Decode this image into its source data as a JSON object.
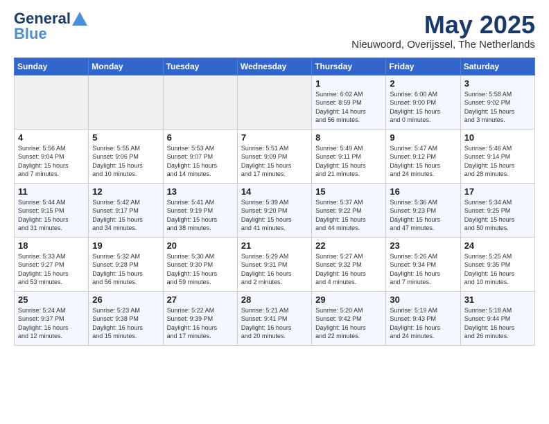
{
  "header": {
    "logo_line1": "General",
    "logo_line2": "Blue",
    "month": "May 2025",
    "location": "Nieuwoord, Overijssel, The Netherlands"
  },
  "days_of_week": [
    "Sunday",
    "Monday",
    "Tuesday",
    "Wednesday",
    "Thursday",
    "Friday",
    "Saturday"
  ],
  "weeks": [
    [
      {
        "day": "",
        "info": ""
      },
      {
        "day": "",
        "info": ""
      },
      {
        "day": "",
        "info": ""
      },
      {
        "day": "",
        "info": ""
      },
      {
        "day": "1",
        "info": "Sunrise: 6:02 AM\nSunset: 8:59 PM\nDaylight: 14 hours\nand 56 minutes."
      },
      {
        "day": "2",
        "info": "Sunrise: 6:00 AM\nSunset: 9:00 PM\nDaylight: 15 hours\nand 0 minutes."
      },
      {
        "day": "3",
        "info": "Sunrise: 5:58 AM\nSunset: 9:02 PM\nDaylight: 15 hours\nand 3 minutes."
      }
    ],
    [
      {
        "day": "4",
        "info": "Sunrise: 5:56 AM\nSunset: 9:04 PM\nDaylight: 15 hours\nand 7 minutes."
      },
      {
        "day": "5",
        "info": "Sunrise: 5:55 AM\nSunset: 9:06 PM\nDaylight: 15 hours\nand 10 minutes."
      },
      {
        "day": "6",
        "info": "Sunrise: 5:53 AM\nSunset: 9:07 PM\nDaylight: 15 hours\nand 14 minutes."
      },
      {
        "day": "7",
        "info": "Sunrise: 5:51 AM\nSunset: 9:09 PM\nDaylight: 15 hours\nand 17 minutes."
      },
      {
        "day": "8",
        "info": "Sunrise: 5:49 AM\nSunset: 9:11 PM\nDaylight: 15 hours\nand 21 minutes."
      },
      {
        "day": "9",
        "info": "Sunrise: 5:47 AM\nSunset: 9:12 PM\nDaylight: 15 hours\nand 24 minutes."
      },
      {
        "day": "10",
        "info": "Sunrise: 5:46 AM\nSunset: 9:14 PM\nDaylight: 15 hours\nand 28 minutes."
      }
    ],
    [
      {
        "day": "11",
        "info": "Sunrise: 5:44 AM\nSunset: 9:15 PM\nDaylight: 15 hours\nand 31 minutes."
      },
      {
        "day": "12",
        "info": "Sunrise: 5:42 AM\nSunset: 9:17 PM\nDaylight: 15 hours\nand 34 minutes."
      },
      {
        "day": "13",
        "info": "Sunrise: 5:41 AM\nSunset: 9:19 PM\nDaylight: 15 hours\nand 38 minutes."
      },
      {
        "day": "14",
        "info": "Sunrise: 5:39 AM\nSunset: 9:20 PM\nDaylight: 15 hours\nand 41 minutes."
      },
      {
        "day": "15",
        "info": "Sunrise: 5:37 AM\nSunset: 9:22 PM\nDaylight: 15 hours\nand 44 minutes."
      },
      {
        "day": "16",
        "info": "Sunrise: 5:36 AM\nSunset: 9:23 PM\nDaylight: 15 hours\nand 47 minutes."
      },
      {
        "day": "17",
        "info": "Sunrise: 5:34 AM\nSunset: 9:25 PM\nDaylight: 15 hours\nand 50 minutes."
      }
    ],
    [
      {
        "day": "18",
        "info": "Sunrise: 5:33 AM\nSunset: 9:27 PM\nDaylight: 15 hours\nand 53 minutes."
      },
      {
        "day": "19",
        "info": "Sunrise: 5:32 AM\nSunset: 9:28 PM\nDaylight: 15 hours\nand 56 minutes."
      },
      {
        "day": "20",
        "info": "Sunrise: 5:30 AM\nSunset: 9:30 PM\nDaylight: 15 hours\nand 59 minutes."
      },
      {
        "day": "21",
        "info": "Sunrise: 5:29 AM\nSunset: 9:31 PM\nDaylight: 16 hours\nand 2 minutes."
      },
      {
        "day": "22",
        "info": "Sunrise: 5:27 AM\nSunset: 9:32 PM\nDaylight: 16 hours\nand 4 minutes."
      },
      {
        "day": "23",
        "info": "Sunrise: 5:26 AM\nSunset: 9:34 PM\nDaylight: 16 hours\nand 7 minutes."
      },
      {
        "day": "24",
        "info": "Sunrise: 5:25 AM\nSunset: 9:35 PM\nDaylight: 16 hours\nand 10 minutes."
      }
    ],
    [
      {
        "day": "25",
        "info": "Sunrise: 5:24 AM\nSunset: 9:37 PM\nDaylight: 16 hours\nand 12 minutes."
      },
      {
        "day": "26",
        "info": "Sunrise: 5:23 AM\nSunset: 9:38 PM\nDaylight: 16 hours\nand 15 minutes."
      },
      {
        "day": "27",
        "info": "Sunrise: 5:22 AM\nSunset: 9:39 PM\nDaylight: 16 hours\nand 17 minutes."
      },
      {
        "day": "28",
        "info": "Sunrise: 5:21 AM\nSunset: 9:41 PM\nDaylight: 16 hours\nand 20 minutes."
      },
      {
        "day": "29",
        "info": "Sunrise: 5:20 AM\nSunset: 9:42 PM\nDaylight: 16 hours\nand 22 minutes."
      },
      {
        "day": "30",
        "info": "Sunrise: 5:19 AM\nSunset: 9:43 PM\nDaylight: 16 hours\nand 24 minutes."
      },
      {
        "day": "31",
        "info": "Sunrise: 5:18 AM\nSunset: 9:44 PM\nDaylight: 16 hours\nand 26 minutes."
      }
    ]
  ]
}
